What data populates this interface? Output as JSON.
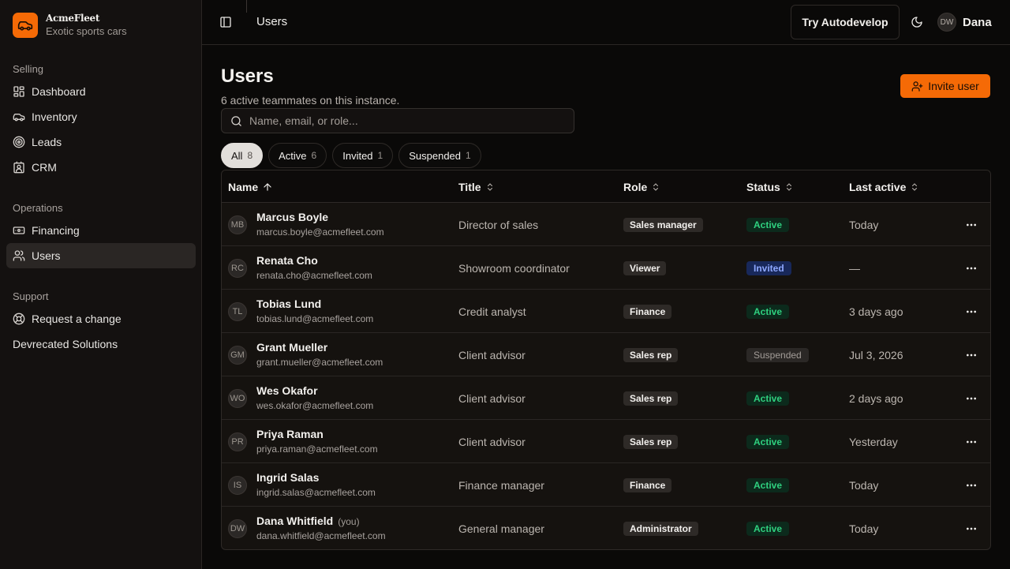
{
  "brand": {
    "name": "AcmeFleet",
    "tagline": "Exotic sports cars",
    "accent": "#f56a06"
  },
  "sidebar": {
    "sections": [
      {
        "heading": "Selling",
        "items": [
          {
            "label": "Dashboard",
            "icon": "dashboard-icon"
          },
          {
            "label": "Inventory",
            "icon": "car-icon"
          },
          {
            "label": "Leads",
            "icon": "target-icon"
          },
          {
            "label": "CRM",
            "icon": "contact-card-icon"
          }
        ]
      },
      {
        "heading": "Operations",
        "items": [
          {
            "label": "Financing",
            "icon": "banknote-icon"
          },
          {
            "label": "Users",
            "icon": "users-icon",
            "active": true
          }
        ]
      },
      {
        "heading": "Support",
        "items": [
          {
            "label": "Request a change",
            "icon": "life-buoy-icon"
          },
          {
            "label": "Devrecated Solutions"
          }
        ]
      }
    ]
  },
  "header": {
    "title": "Users",
    "try_label": "Try Autodevelop",
    "user_initials": "DW",
    "user_name": "Dana"
  },
  "page": {
    "title": "Users",
    "subtitle": "6 active teammates on this instance.",
    "invite_label": "Invite user",
    "search_placeholder": "Name, email, or role..."
  },
  "filters": [
    {
      "label": "All",
      "count": "8",
      "active": true
    },
    {
      "label": "Active",
      "count": "6"
    },
    {
      "label": "Invited",
      "count": "1"
    },
    {
      "label": "Suspended",
      "count": "1"
    }
  ],
  "table": {
    "columns": [
      "Name",
      "Title",
      "Role",
      "Status",
      "Last active"
    ],
    "rows": [
      {
        "initials": "MB",
        "name": "Marcus Boyle",
        "email": "marcus.boyle@acmefleet.com",
        "title": "Director of sales",
        "role": "Sales manager",
        "status": "Active",
        "last": "Today"
      },
      {
        "initials": "RC",
        "name": "Renata Cho",
        "email": "renata.cho@acmefleet.com",
        "title": "Showroom coordinator",
        "role": "Viewer",
        "status": "Invited",
        "last": "—"
      },
      {
        "initials": "TL",
        "name": "Tobias Lund",
        "email": "tobias.lund@acmefleet.com",
        "title": "Credit analyst",
        "role": "Finance",
        "status": "Active",
        "last": "3 days ago"
      },
      {
        "initials": "GM",
        "name": "Grant Mueller",
        "email": "grant.mueller@acmefleet.com",
        "title": "Client advisor",
        "role": "Sales rep",
        "status": "Suspended",
        "last": "Jul 3, 2026"
      },
      {
        "initials": "WO",
        "name": "Wes Okafor",
        "email": "wes.okafor@acmefleet.com",
        "title": "Client advisor",
        "role": "Sales rep",
        "status": "Active",
        "last": "2 days ago"
      },
      {
        "initials": "PR",
        "name": "Priya Raman",
        "email": "priya.raman@acmefleet.com",
        "title": "Client advisor",
        "role": "Sales rep",
        "status": "Active",
        "last": "Yesterday"
      },
      {
        "initials": "IS",
        "name": "Ingrid Salas",
        "email": "ingrid.salas@acmefleet.com",
        "title": "Finance manager",
        "role": "Finance",
        "status": "Active",
        "last": "Today"
      },
      {
        "initials": "DW",
        "name": "Dana Whitfield",
        "you": "(you)",
        "email": "dana.whitfield@acmefleet.com",
        "title": "General manager",
        "role": "Administrator",
        "status": "Active",
        "last": "Today"
      }
    ]
  }
}
